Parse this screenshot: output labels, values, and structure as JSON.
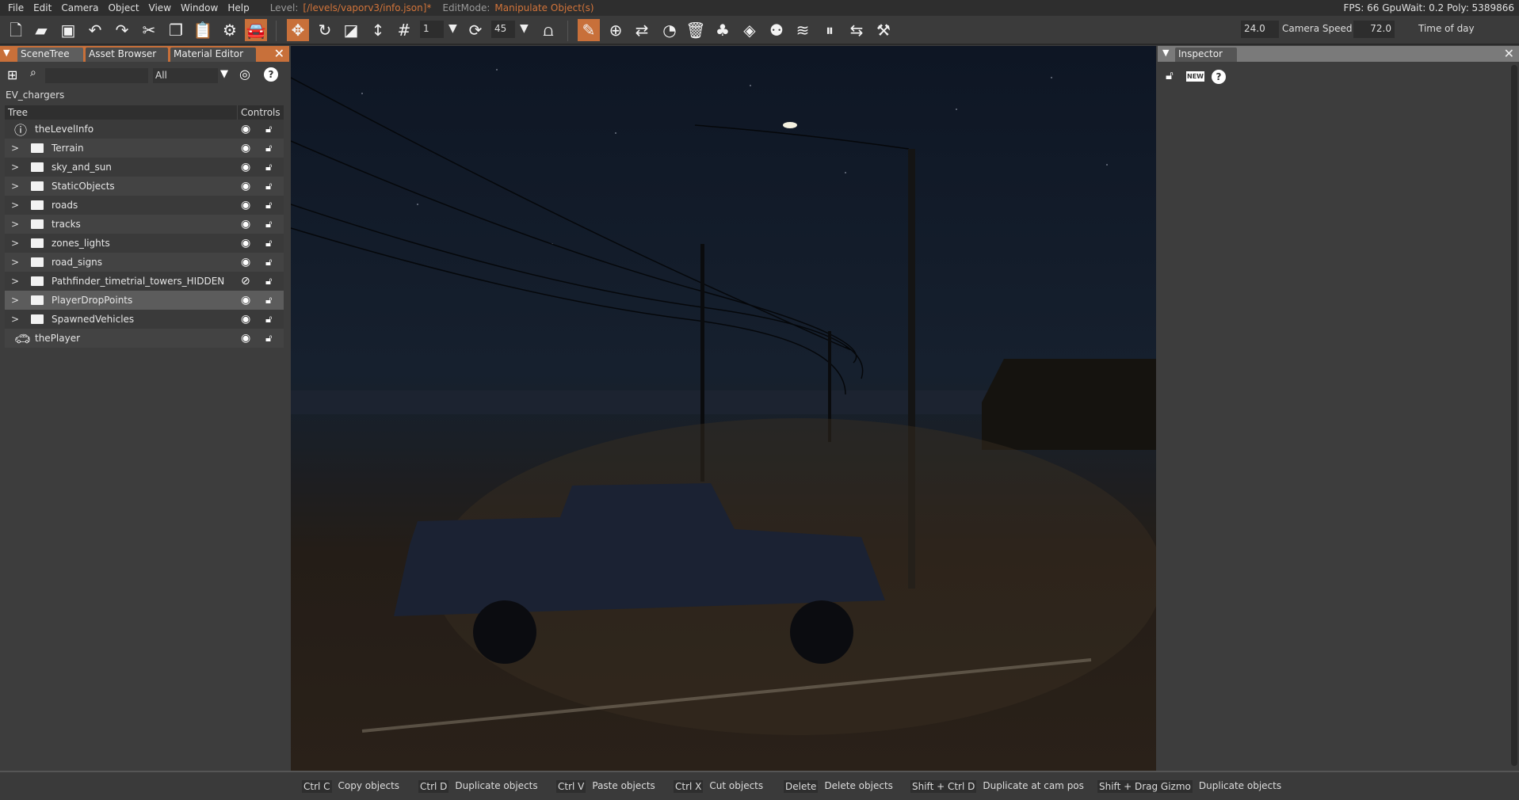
{
  "menu": {
    "items": [
      "File",
      "Edit",
      "Camera",
      "Object",
      "View",
      "Window",
      "Help"
    ],
    "level_label": "Level:",
    "level_value": "[/levels/vaporv3/info.json]*",
    "editmode_label": "EditMode:",
    "editmode_value": "Manipulate Object(s)",
    "stats": "FPS: 66  GpuWait: 0.2  Poly: 5389866"
  },
  "toolbar": {
    "snap_value": "1",
    "rotate_snap_value": "45",
    "camera_speed_value": "24.0",
    "camera_speed_label": "Camera Speed",
    "time_of_day_value": "72.0",
    "time_of_day_label": "Time of day"
  },
  "scene_panel": {
    "tabs": [
      "SceneTree",
      "Asset Browser",
      "Material Editor"
    ],
    "filter": "All",
    "breadcrumb": "EV_chargers",
    "col_tree": "Tree",
    "col_controls": "Controls",
    "rows": [
      {
        "name": "theLevelInfo",
        "icon": "info-icon",
        "hidden": false
      },
      {
        "name": "Terrain",
        "icon": "folder-icon",
        "hidden": false
      },
      {
        "name": "sky_and_sun",
        "icon": "folder-icon",
        "hidden": false
      },
      {
        "name": "StaticObjects",
        "icon": "folder-icon",
        "hidden": false
      },
      {
        "name": "roads",
        "icon": "folder-icon",
        "hidden": false
      },
      {
        "name": "tracks",
        "icon": "folder-icon",
        "hidden": false
      },
      {
        "name": "zones_lights",
        "icon": "folder-icon",
        "hidden": false
      },
      {
        "name": "road_signs",
        "icon": "folder-icon",
        "hidden": false
      },
      {
        "name": "Pathfinder_timetrial_towers_HIDDEN",
        "icon": "folder-icon",
        "hidden": true
      },
      {
        "name": "PlayerDropPoints",
        "icon": "folder-icon",
        "hidden": false,
        "selected": true
      },
      {
        "name": "SpawnedVehicles",
        "icon": "folder-icon",
        "hidden": false
      },
      {
        "name": "thePlayer",
        "icon": "car-icon",
        "hidden": false
      }
    ]
  },
  "inspector": {
    "title": "Inspector",
    "new_label": "NEW"
  },
  "status": {
    "shortcuts": [
      {
        "key": "Ctrl C",
        "action": "Copy objects"
      },
      {
        "key": "Ctrl D",
        "action": "Duplicate objects"
      },
      {
        "key": "Ctrl V",
        "action": "Paste objects"
      },
      {
        "key": "Ctrl X",
        "action": "Cut objects"
      },
      {
        "key": "Delete",
        "action": "Delete objects"
      },
      {
        "key": "Shift + Ctrl D",
        "action": "Duplicate at cam pos"
      },
      {
        "key": "Shift + Drag Gizmo",
        "action": "Duplicate objects"
      }
    ]
  },
  "colors": {
    "accent": "#c8703a",
    "bg": "#3d3d3d"
  }
}
